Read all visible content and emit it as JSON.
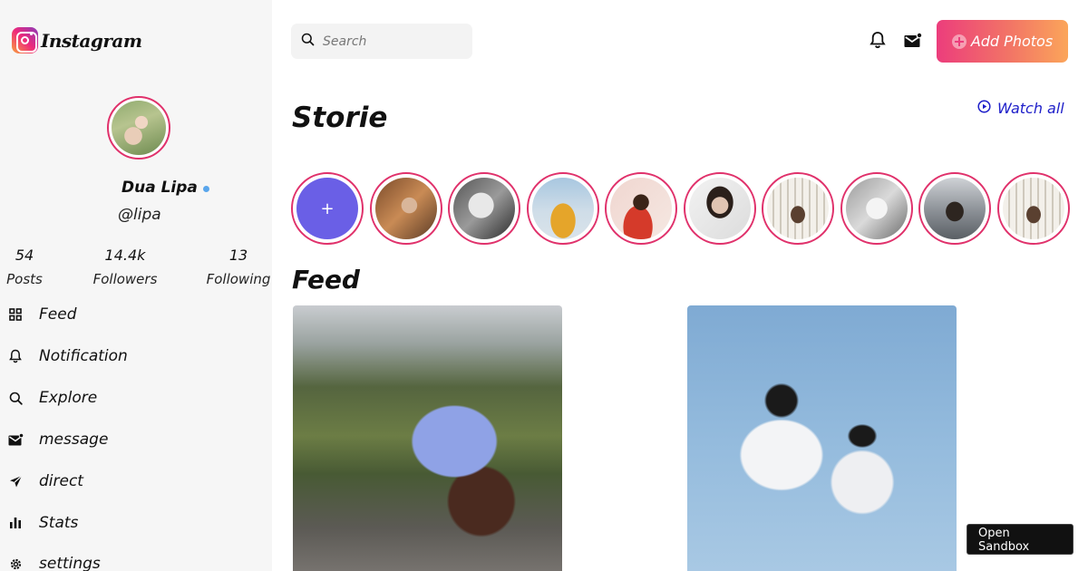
{
  "app": {
    "logo_text": "Instagram"
  },
  "profile": {
    "name": "Dua Lipa",
    "handle": "@lipa",
    "stats": [
      {
        "value": "54",
        "label": "Posts"
      },
      {
        "value": "14.4k",
        "label": "Followers"
      },
      {
        "value": "13",
        "label": "Following"
      }
    ]
  },
  "sidebar": {
    "items": [
      {
        "label": "Feed",
        "icon": "grid-icon"
      },
      {
        "label": "Notification",
        "icon": "bell-icon"
      },
      {
        "label": "Explore",
        "icon": "search-icon"
      },
      {
        "label": "message",
        "icon": "mail-icon"
      },
      {
        "label": "direct",
        "icon": "send-icon"
      },
      {
        "label": "Stats",
        "icon": "bar-chart-icon"
      },
      {
        "label": "settings",
        "icon": "gear-icon"
      }
    ]
  },
  "header": {
    "search_placeholder": "Search",
    "add_photos_label": "Add Photos"
  },
  "stories": {
    "title": "Storie",
    "watch_all_label": "Watch all",
    "add_symbol": "+"
  },
  "feed": {
    "title": "Feed"
  },
  "sandbox": {
    "label": "Open Sandbox"
  },
  "colors": {
    "accent_ring": "#e0316b",
    "link_blue": "#1d1ec9",
    "add_gradient_start": "#ec3d7c",
    "add_gradient_end": "#fba55a",
    "online_dot": "#5aa6ec",
    "sidebar_bg": "#f6f6f6"
  }
}
